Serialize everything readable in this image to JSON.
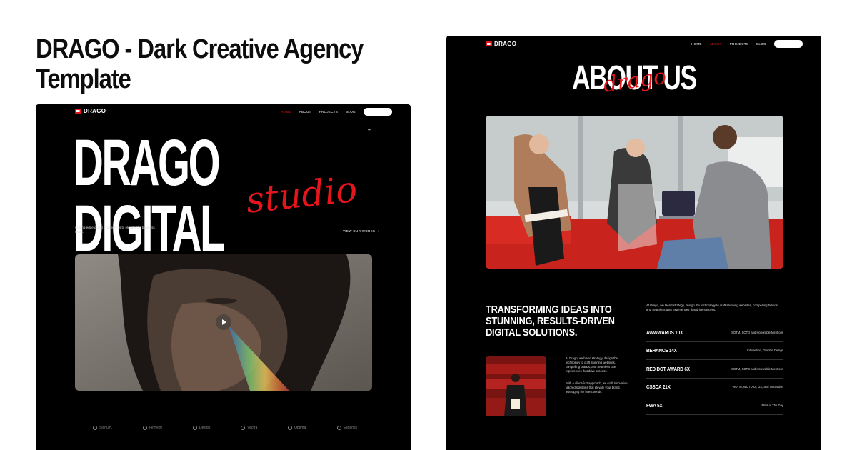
{
  "headline": "DRAGO - Dark Creative Agency Template",
  "colors": {
    "accent": "#e4161b",
    "dark": "#000000",
    "text": "#ffffff"
  },
  "home": {
    "logo": "DRAGO",
    "nav": [
      {
        "label": "HOME",
        "active": true
      },
      {
        "label": "ABOUT",
        "active": false
      },
      {
        "label": "PROJECTS",
        "active": false
      },
      {
        "label": "BLOG",
        "active": false
      }
    ],
    "contact": "CONTACT",
    "hero_title": "DRAGO DIGITAL",
    "hero_script": "studio",
    "trademark": "™",
    "tagline": "Cutting-edge digital experiences to elevate the business ideas.",
    "view_works": "VIEW OUR WORKS",
    "view_works_icon": "chevron-right-icon",
    "video_play_icon": "play-icon",
    "clients": [
      "Signum.",
      "Firmedy",
      "Design",
      "Vectra",
      "Optimal",
      "Essentis"
    ]
  },
  "about": {
    "logo": "DRAGO",
    "nav": [
      {
        "label": "HOME",
        "active": false
      },
      {
        "label": "ABOUT",
        "active": true
      },
      {
        "label": "PROJECTS",
        "active": false
      },
      {
        "label": "BLOG",
        "active": false
      }
    ],
    "contact": "CONTACT",
    "title": "ABOUT US",
    "title_script": "drago",
    "intro": "At Drago, we blend strategy, design the technology to craft stunning websites, compelling brands, and seamless user experiences that drive success.",
    "heading": "TRANSFORMING IDEAS INTO STUNNING, RESULTS-DRIVEN DIGITAL SOLUTIONS.",
    "para1": "At Drago, we blend strategy, design the technology to craft stunning websites, compelling brands, and seamless user experiences that drive success.",
    "para2": "With a client-first approach, we craft innovative, tailored solutions that elevate your brand, leveraging the latest trends.",
    "awards": [
      {
        "name": "AWWWARDS 10X",
        "desc": "SOTM, SOTD and Honorable Mentions"
      },
      {
        "name": "BEHANCE 14X",
        "desc": "Interaction, Graphic Design"
      },
      {
        "name": "RED DOT AWARD 6X",
        "desc": "SOTM, SOTD and Honorable Mentions"
      },
      {
        "name": "CSSDA 21X",
        "desc": "WOTM, WOTD,UI, UX, and Innovation"
      },
      {
        "name": "FWA 5X",
        "desc": "FWA of The Day"
      }
    ]
  }
}
